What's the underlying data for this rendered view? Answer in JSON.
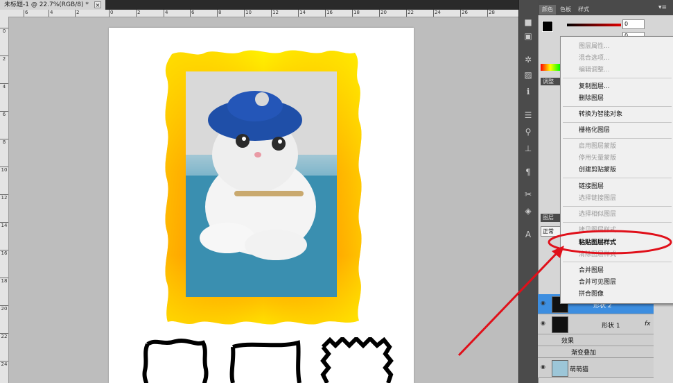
{
  "document": {
    "tab_title": "未标题-1 @ 22.7%(RGB/8) *",
    "close_glyph": "×"
  },
  "rulers": {
    "horizontal_ticks": [
      "6",
      "4",
      "2",
      "0",
      "2",
      "4",
      "6",
      "8",
      "10",
      "12",
      "14",
      "16",
      "18",
      "20",
      "22",
      "24",
      "26",
      "28"
    ],
    "vertical_ticks": [
      "0",
      "2",
      "4",
      "6",
      "8",
      "10",
      "12",
      "14",
      "16",
      "18",
      "20",
      "22",
      "24"
    ]
  },
  "panel": {
    "tabs": [
      "颜色",
      "色板",
      "样式"
    ],
    "color_value": "0",
    "color_value2": "0",
    "adjust_tab": "调整",
    "layers_tab": "图层",
    "blend_mode": "正常"
  },
  "context_menu": {
    "items": [
      {
        "label": "图层属性...",
        "enabled": false
      },
      {
        "label": "混合选项...",
        "enabled": false
      },
      {
        "label": "编辑调整...",
        "enabled": false
      },
      {
        "label": "复制图层...",
        "enabled": true
      },
      {
        "label": "删除图层",
        "enabled": true
      },
      {
        "label": "转换为智能对象",
        "enabled": true
      },
      {
        "label": "栅格化图层",
        "enabled": true
      },
      {
        "label": "启用图层蒙版",
        "enabled": false
      },
      {
        "label": "停用矢量蒙版",
        "enabled": false
      },
      {
        "label": "创建剪贴蒙版",
        "enabled": true
      },
      {
        "label": "链接图层",
        "enabled": true
      },
      {
        "label": "选择链接图层",
        "enabled": false
      },
      {
        "label": "选择相似图层",
        "enabled": false
      },
      {
        "label": "拷贝图层样式",
        "enabled": false
      },
      {
        "label": "粘贴图层样式",
        "enabled": true
      },
      {
        "label": "清除图层样式",
        "enabled": false
      },
      {
        "label": "合并图层",
        "enabled": true
      },
      {
        "label": "合并可见图层",
        "enabled": true
      },
      {
        "label": "拼合图像",
        "enabled": true
      }
    ]
  },
  "layers": {
    "shape2": "形状 2",
    "shape1": "形状 1",
    "fx": "fx",
    "effects": "效果",
    "gradient_overlay": "渐变叠加",
    "cat_layer": "萌萌猫"
  },
  "colors": {
    "frame_top": "#fff200",
    "frame_mid": "#ff8c00",
    "annotation_red": "#e0101a",
    "layer_selected": "#3d8ee0"
  }
}
